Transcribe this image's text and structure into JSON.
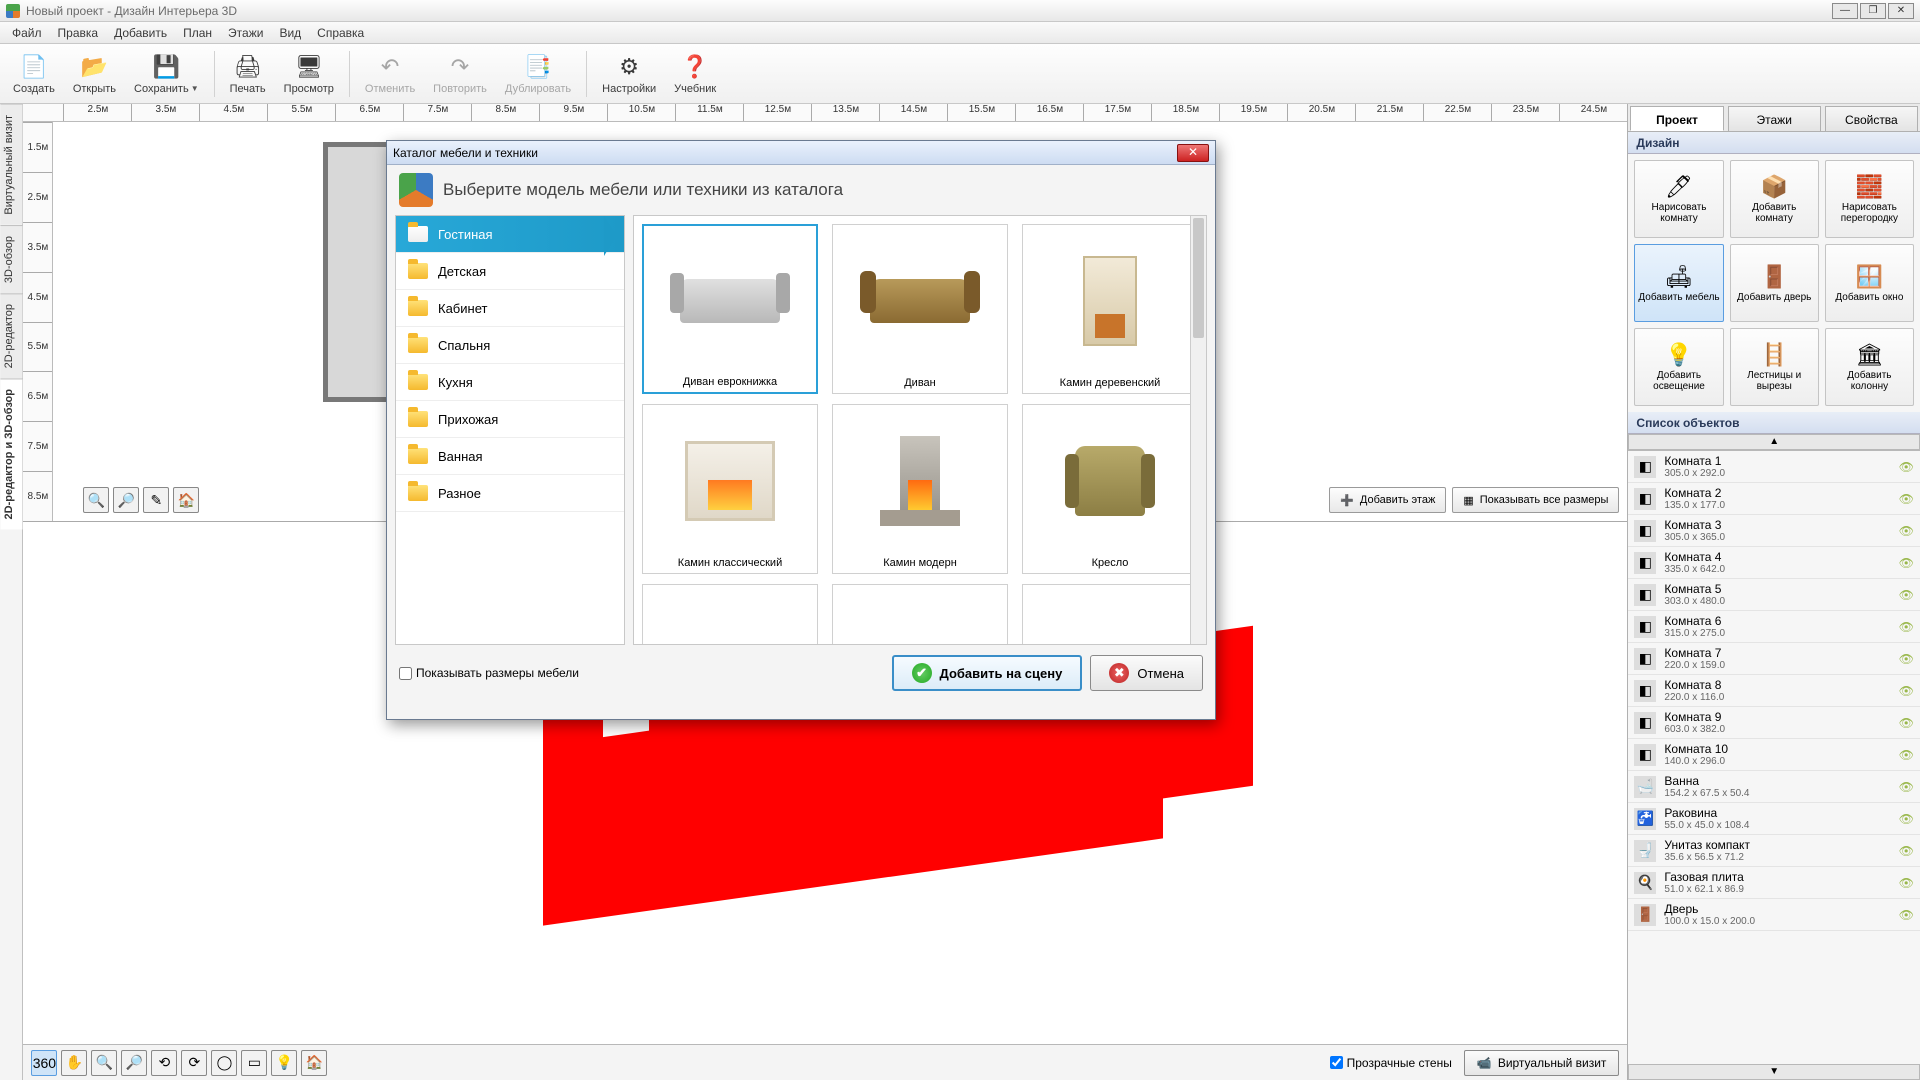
{
  "titlebar": {
    "title": "Новый проект - Дизайн Интерьера 3D"
  },
  "menu": [
    "Файл",
    "Правка",
    "Добавить",
    "План",
    "Этажи",
    "Вид",
    "Справка"
  ],
  "toolbar": [
    {
      "id": "create",
      "label": "Создать",
      "icon": "📄"
    },
    {
      "id": "open",
      "label": "Открыть",
      "icon": "📂"
    },
    {
      "id": "save",
      "label": "Сохранить",
      "icon": "💾",
      "dd": true
    },
    {
      "sep": true
    },
    {
      "id": "print",
      "label": "Печать",
      "icon": "🖨"
    },
    {
      "id": "preview",
      "label": "Просмотр",
      "icon": "🖥"
    },
    {
      "sep": true
    },
    {
      "id": "undo",
      "label": "Отменить",
      "icon": "↶",
      "disabled": true
    },
    {
      "id": "redo",
      "label": "Повторить",
      "icon": "↷",
      "disabled": true
    },
    {
      "id": "dup",
      "label": "Дублировать",
      "icon": "📑",
      "disabled": true
    },
    {
      "sep": true
    },
    {
      "id": "settings",
      "label": "Настройки",
      "icon": "⚙"
    },
    {
      "id": "tutorial",
      "label": "Учебник",
      "icon": "❓"
    }
  ],
  "vtabs": [
    "Виртуальный визит",
    "3D-обзор",
    "2D-редактор",
    "2D-редактор и 3D-обзор"
  ],
  "ruler_h": [
    "2.5м",
    "3.5м",
    "4.5м",
    "5.5м",
    "6.5м",
    "7.5м",
    "8.5м",
    "9.5м",
    "10.5м",
    "11.5м",
    "12.5м",
    "13.5м",
    "14.5м",
    "15.5м",
    "16.5м",
    "17.5м",
    "18.5м",
    "19.5м",
    "20.5м",
    "21.5м",
    "22.5м",
    "23.5м",
    "24.5м"
  ],
  "ruler_v": [
    "1.5м",
    "2.5м",
    "3.5м",
    "4.5м",
    "5.5м",
    "6.5м",
    "7.5м",
    "8.5м"
  ],
  "canvas_buttons": {
    "add_floor": "Добавить этаж",
    "show_dims": "Показывать все размеры"
  },
  "bottom": {
    "transparent": "Прозрачные стены",
    "visit": "Виртуальный визит"
  },
  "rp_tabs": [
    "Проект",
    "Этажи",
    "Свойства"
  ],
  "design_section": "Дизайн",
  "design_items": [
    {
      "label": "Нарисовать комнату",
      "icon": "🖊"
    },
    {
      "label": "Добавить комнату",
      "icon": "📦"
    },
    {
      "label": "Нарисовать перегородку",
      "icon": "🧱"
    },
    {
      "label": "Добавить мебель",
      "icon": "🛋",
      "active": true
    },
    {
      "label": "Добавить дверь",
      "icon": "🚪"
    },
    {
      "label": "Добавить окно",
      "icon": "🪟"
    },
    {
      "label": "Добавить освещение",
      "icon": "💡"
    },
    {
      "label": "Лестницы и вырезы",
      "icon": "🪜"
    },
    {
      "label": "Добавить колонну",
      "icon": "🏛"
    }
  ],
  "objects_section": "Список объектов",
  "objects": [
    {
      "name": "Комната 1",
      "dim": "305.0 x 292.0",
      "icon": "◧"
    },
    {
      "name": "Комната 2",
      "dim": "135.0 x 177.0",
      "icon": "◧"
    },
    {
      "name": "Комната 3",
      "dim": "305.0 x 365.0",
      "icon": "◧"
    },
    {
      "name": "Комната 4",
      "dim": "335.0 x 642.0",
      "icon": "◧"
    },
    {
      "name": "Комната 5",
      "dim": "303.0 x 480.0",
      "icon": "◧"
    },
    {
      "name": "Комната 6",
      "dim": "315.0 x 275.0",
      "icon": "◧"
    },
    {
      "name": "Комната 7",
      "dim": "220.0 x 159.0",
      "icon": "◧"
    },
    {
      "name": "Комната 8",
      "dim": "220.0 x 116.0",
      "icon": "◧"
    },
    {
      "name": "Комната 9",
      "dim": "603.0 x 382.0",
      "icon": "◧"
    },
    {
      "name": "Комната 10",
      "dim": "140.0 x 296.0",
      "icon": "◧"
    },
    {
      "name": "Ванна",
      "dim": "154.2 x 67.5 x 50.4",
      "icon": "🛁"
    },
    {
      "name": "Раковина",
      "dim": "55.0 x 45.0 x 108.4",
      "icon": "🚰"
    },
    {
      "name": "Унитаз компакт",
      "dim": "35.6 x 56.5 x 71.2",
      "icon": "🚽"
    },
    {
      "name": "Газовая плита",
      "dim": "51.0 x 62.1 x 86.9",
      "icon": "🍳"
    },
    {
      "name": "Дверь",
      "dim": "100.0 x 15.0 x 200.0",
      "icon": "🚪"
    }
  ],
  "dialog": {
    "title": "Каталог мебели и техники",
    "header": "Выберите модель мебели или техники из каталога",
    "categories": [
      "Гостиная",
      "Детская",
      "Кабинет",
      "Спальня",
      "Кухня",
      "Прихожая",
      "Ванная",
      "Разное"
    ],
    "items": [
      {
        "label": "Диван еврокнижка",
        "shape": "sofa-gray",
        "sel": true
      },
      {
        "label": "Диван",
        "shape": "sofa-brown"
      },
      {
        "label": "Камин деревенский",
        "shape": "fireplace1"
      },
      {
        "label": "Камин классический",
        "shape": "fireplace2"
      },
      {
        "label": "Камин модерн",
        "shape": "fireplace3"
      },
      {
        "label": "Кресло",
        "shape": "armchair"
      },
      {
        "label": "",
        "shape": ""
      },
      {
        "label": "",
        "shape": ""
      },
      {
        "label": "",
        "shape": ""
      }
    ],
    "show_sizes": "Показывать размеры мебели",
    "add": "Добавить на сцену",
    "cancel": "Отмена"
  }
}
